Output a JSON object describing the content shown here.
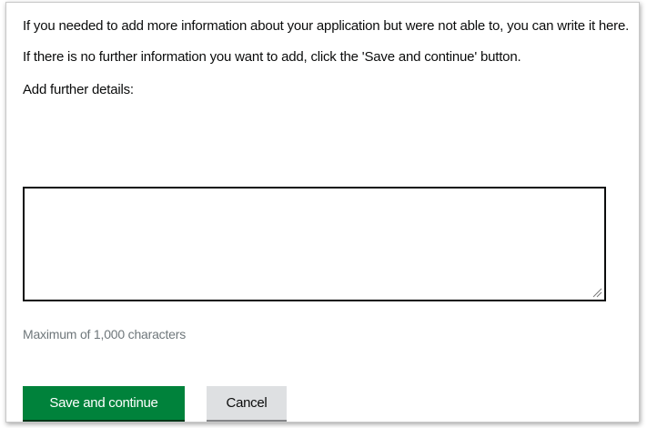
{
  "intro": {
    "paragraph1": "If you needed to add more information about your application but were not able to, you can write it here.",
    "paragraph2": "If there is no further information you want to add, click the 'Save and continue' button."
  },
  "form": {
    "details_label": "Add further details:",
    "details_value": "",
    "max_hint": "Maximum of 1,000 characters"
  },
  "actions": {
    "save_label": "Save and continue",
    "cancel_label": "Cancel"
  },
  "colors": {
    "primary_button": "#00823b",
    "secondary_button": "#dee0e2",
    "hint_text": "#6f777b"
  }
}
